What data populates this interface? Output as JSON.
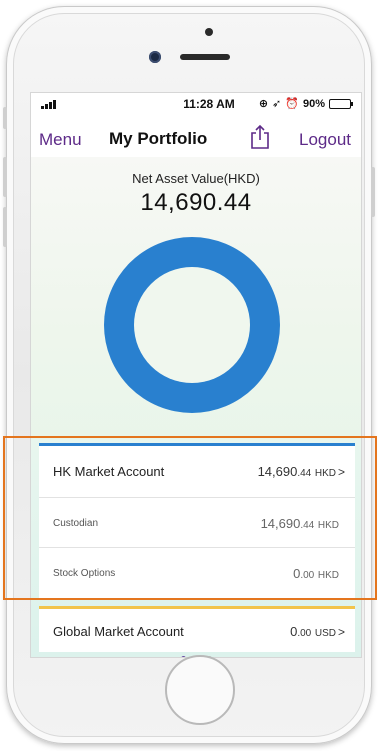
{
  "status_bar": {
    "time": "11:28 AM",
    "battery": "90%",
    "battery_level": 0.9,
    "icons": [
      "signal-icon",
      "lock-rotation-icon",
      "location-icon",
      "alarm-icon",
      "battery-icon"
    ]
  },
  "nav": {
    "menu_label": "Menu",
    "title": "My Portfolio",
    "share_icon": "share-icon",
    "logout_label": "Logout"
  },
  "summary": {
    "label": "Net Asset Value(HKD)",
    "value": "14,690.44"
  },
  "chart_data": {
    "type": "pie",
    "categories": [
      "HK Market Account"
    ],
    "values": [
      14690.44
    ],
    "colors": [
      "#2980cf"
    ]
  },
  "accounts": {
    "hk": {
      "name": "HK Market Account",
      "value_int": "14,690",
      "value_dec": ".44",
      "currency": "HKD",
      "accent": "#2980cf",
      "rows": [
        {
          "label": "Custodian",
          "value_int": "14,690",
          "value_dec": ".44",
          "currency": "HKD"
        },
        {
          "label": "Stock Options",
          "value_int": "0",
          "value_dec": ".00",
          "currency": "HKD"
        }
      ]
    },
    "global": {
      "name": "Global Market Account",
      "value_int": "0",
      "value_dec": ".00",
      "currency": "USD",
      "accent": "#f2c44a"
    }
  },
  "pagination": {
    "pages": 3,
    "active": 1
  },
  "colors": {
    "brand_purple": "#5d2a88",
    "highlight_orange": "#e4751e"
  }
}
